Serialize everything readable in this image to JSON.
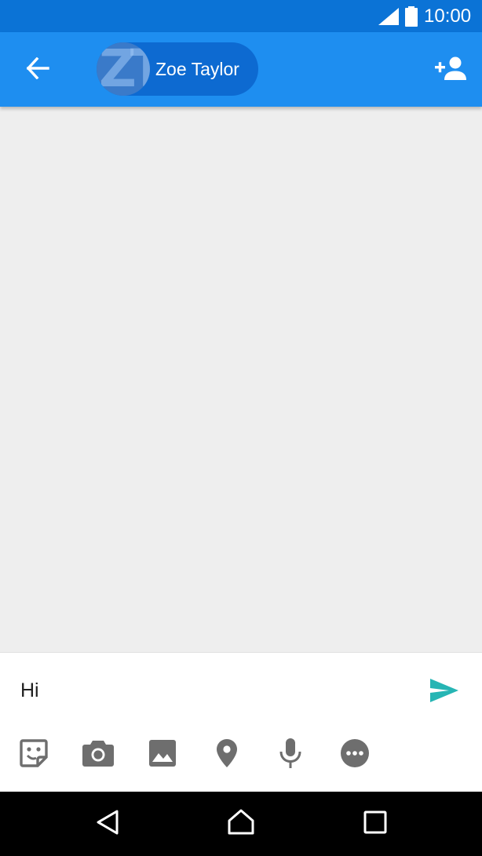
{
  "status_bar": {
    "time": "10:00",
    "icons": [
      "signal-icon",
      "battery-icon"
    ]
  },
  "app_bar": {
    "back_icon": "arrow-back-icon",
    "contact": {
      "avatar_initials": "ZT",
      "name": "Zoe Taylor"
    },
    "add_person_icon": "person-add-icon"
  },
  "compose": {
    "message_value": "Hi",
    "send_icon": "send-icon",
    "send_color": "#26b5b4",
    "tools": [
      "sticker-icon",
      "camera-icon",
      "image-icon",
      "location-icon",
      "microphone-icon",
      "more-icon"
    ]
  },
  "nav_bar": {
    "icons": [
      "back-triangle-icon",
      "home-icon",
      "recents-icon"
    ]
  },
  "colors": {
    "status_bar": "#0b73d6",
    "app_bar": "#1e8ef0",
    "chip": "#0d6ad1",
    "icon_gray": "#6e6e6e"
  }
}
